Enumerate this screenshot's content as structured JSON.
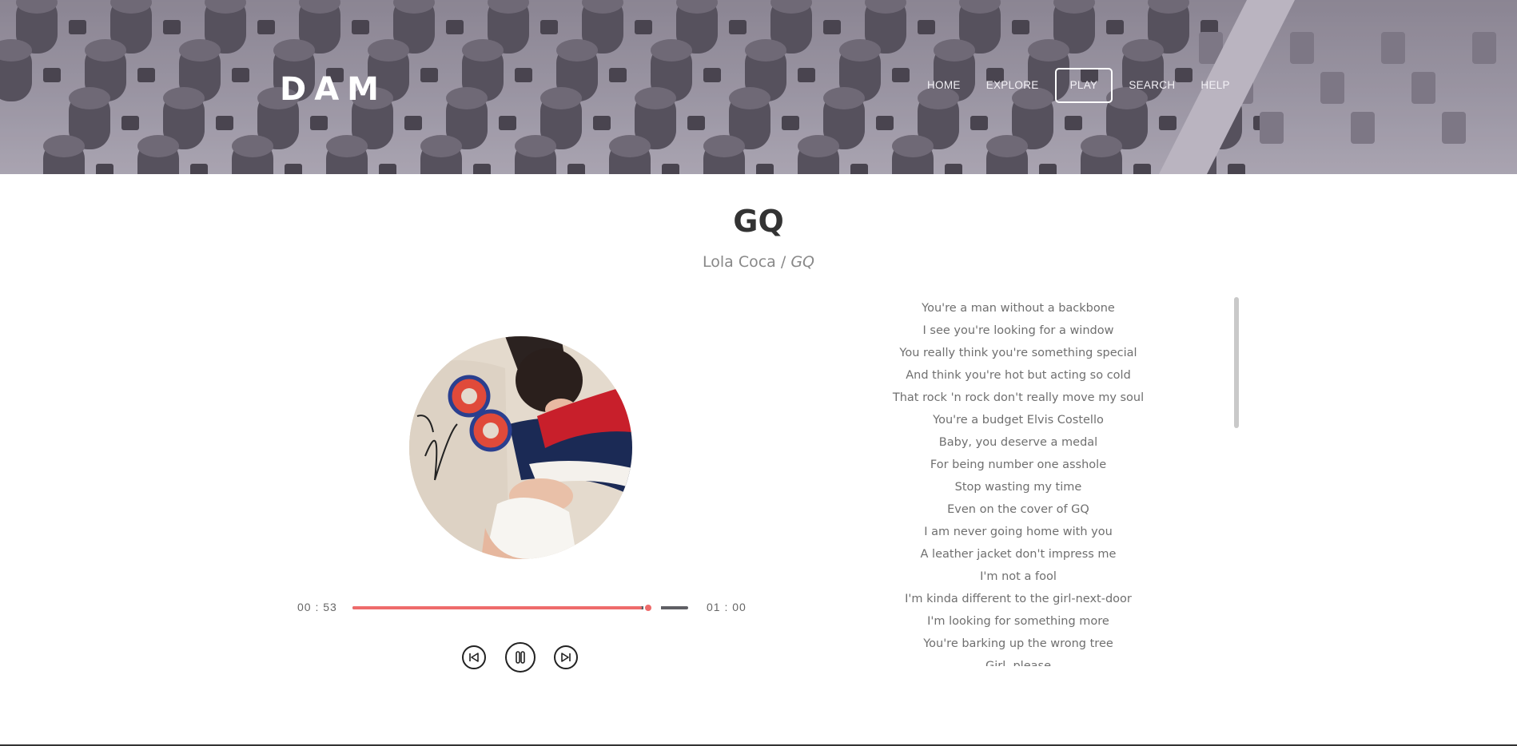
{
  "header": {
    "logo": "DAM",
    "nav": [
      {
        "label": "HOME",
        "active": false
      },
      {
        "label": "EXPLORE",
        "active": false
      },
      {
        "label": "PLAY",
        "active": true
      },
      {
        "label": "SEARCH",
        "active": false
      },
      {
        "label": "HELP",
        "active": false
      }
    ]
  },
  "song": {
    "title": "GQ",
    "artist": "Lola Coca",
    "separator": " / ",
    "album": "GQ"
  },
  "player": {
    "current_time": "00 :  53",
    "duration": "01 :  00",
    "progress": 0.88,
    "state": "playing"
  },
  "lyrics": [
    "You're a man without a backbone",
    "I see you're looking for a window",
    "You really think you're something special",
    "And think you're hot but acting so cold",
    "That rock 'n rock don't really move my soul",
    "You're a budget Elvis Costello",
    "Baby, you deserve a medal",
    "For being number one asshole",
    "Stop wasting my time",
    "Even on the cover of GQ",
    "I am never going home with you",
    "A leather jacket don't impress me",
    "I'm not a fool",
    "I'm kinda different to the girl-next-door",
    "I'm looking for something more",
    "You're barking up the wrong tree",
    "Girl, please"
  ],
  "colors": {
    "accent": "#ee6b6b",
    "track": "#5f5f64",
    "header_tint": "#a29eaa"
  },
  "icons": {
    "prev": "skip-back-icon",
    "play": "pause-icon",
    "next": "skip-forward-icon"
  }
}
